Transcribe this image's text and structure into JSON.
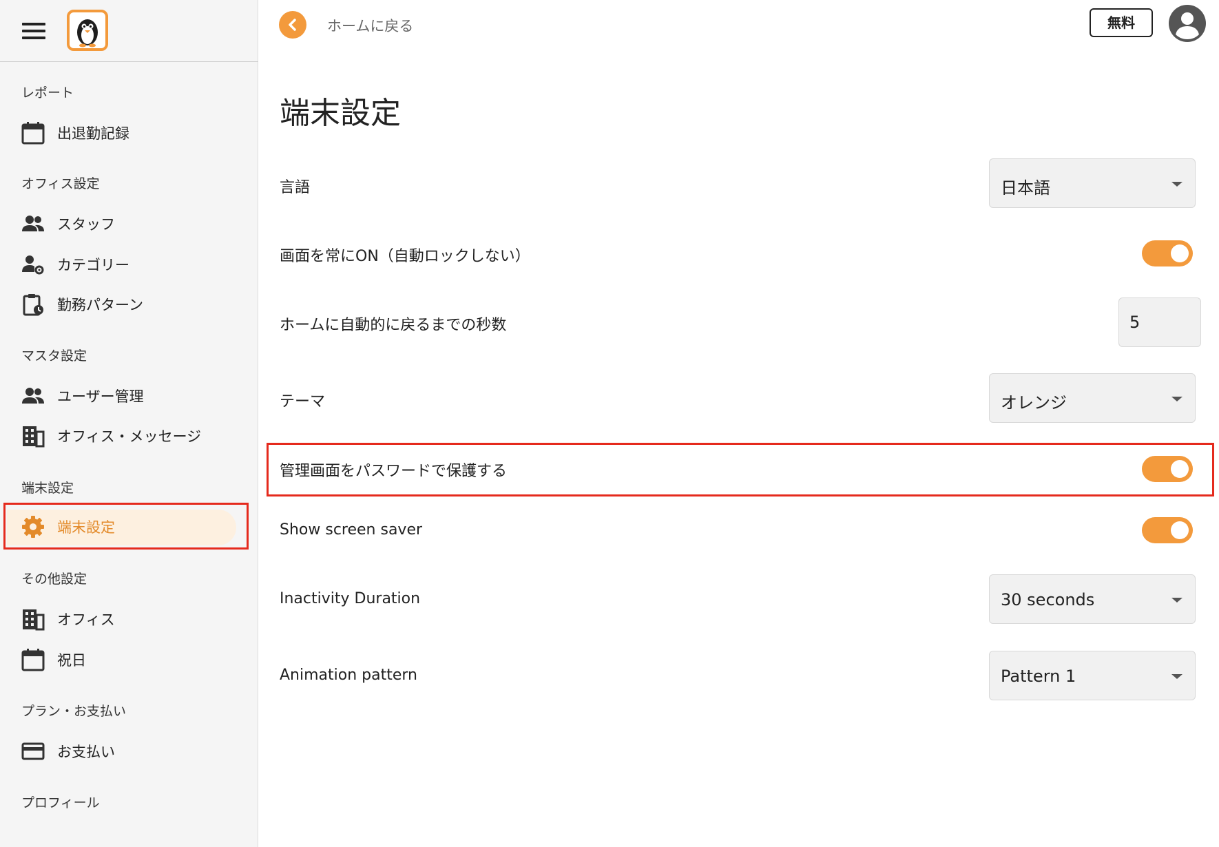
{
  "sidebar": {
    "sections": [
      {
        "title": "レポート",
        "items": [
          {
            "label": "出退勤記録",
            "icon": "calendar-icon"
          }
        ]
      },
      {
        "title": "オフィス設定",
        "items": [
          {
            "label": "スタッフ",
            "icon": "people-icon"
          },
          {
            "label": "カテゴリー",
            "icon": "person-gear-icon"
          },
          {
            "label": "勤務パターン",
            "icon": "clipboard-clock-icon"
          }
        ]
      },
      {
        "title": "マスタ設定",
        "items": [
          {
            "label": "ユーザー管理",
            "icon": "people-icon"
          },
          {
            "label": "オフィス・メッセージ",
            "icon": "building-icon"
          }
        ]
      },
      {
        "title": "端末設定",
        "items": [
          {
            "label": "端末設定",
            "icon": "gear-icon",
            "active": true
          }
        ]
      },
      {
        "title": "その他設定",
        "items": [
          {
            "label": "オフィス",
            "icon": "building-icon"
          },
          {
            "label": "祝日",
            "icon": "calendar-icon"
          }
        ]
      },
      {
        "title": "プラン・お支払い",
        "items": [
          {
            "label": "お支払い",
            "icon": "credit-card-icon"
          }
        ]
      },
      {
        "title": "プロフィール",
        "items": []
      }
    ]
  },
  "topbar": {
    "back_label": "ホームに戻る",
    "plan_badge": "無料"
  },
  "main": {
    "title": "端末設定",
    "settings": {
      "language": {
        "label": "言語",
        "value": "日本語"
      },
      "screen_always_on": {
        "label": "画面を常にON（自動ロックしない）",
        "enabled": true
      },
      "auto_return": {
        "label": "ホームに自動的に戻るまでの秒数",
        "value": "5"
      },
      "theme": {
        "label": "テーマ",
        "value": "オレンジ"
      },
      "password_protect": {
        "label": "管理画面をパスワードで保護する",
        "enabled": true
      },
      "screen_saver": {
        "label": "Show screen saver",
        "enabled": true
      },
      "inactivity": {
        "label": "Inactivity Duration",
        "value": "30 seconds"
      },
      "animation": {
        "label": "Animation pattern",
        "value": "Pattern 1"
      }
    }
  },
  "colors": {
    "accent": "#f39a3c",
    "active_bg": "#fdf0e0",
    "active_text": "#e38a2a",
    "highlight_border": "#e52a1d"
  }
}
